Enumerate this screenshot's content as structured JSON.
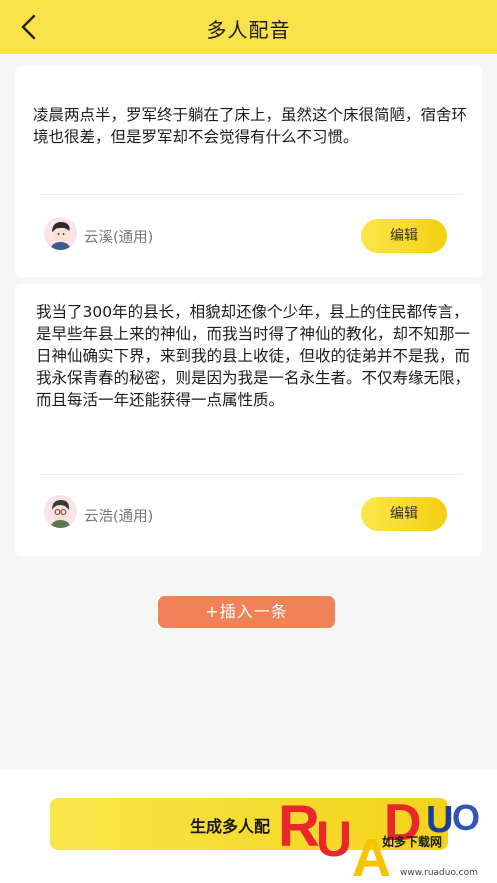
{
  "header": {
    "title": "多人配音",
    "back_icon": "chevron-left-icon",
    "background": "#f7e24a"
  },
  "cards": [
    {
      "text": "凌晨两点半，罗军终于躺在了床上，虽然这个床很简陋，宿舍环境也很差，但是罗军却不会觉得有什么不习惯。",
      "voice": "云溪(通用)",
      "edit_label": "编辑"
    },
    {
      "text": "我当了300年的县长，相貌却还像个少年，县上的住民都传言，是早些年县上来的神仙，而我当时得了神仙的教化，却不知那一日神仙确实下界，来到我的县上收徒，但收的徒弟并不是我，而我永保青春的秘密，则是因为我是一名永生者。不仅寿缘无限，而且每活一年还能获得一点属性质。",
      "voice": "云浩(通用)",
      "edit_label": "编辑"
    }
  ],
  "insert_label": "+插入一条",
  "generate_label": "生成多人配",
  "watermark": {
    "brand": "RUANDUO",
    "subtitle": "如多下载网",
    "url": "www.ruaduo.com"
  },
  "colors": {
    "accent_yellow": "#f4d21a",
    "insert_orange": "#ef8257",
    "watermark_red": "#e8262b",
    "watermark_yellow": "#f5c400"
  }
}
